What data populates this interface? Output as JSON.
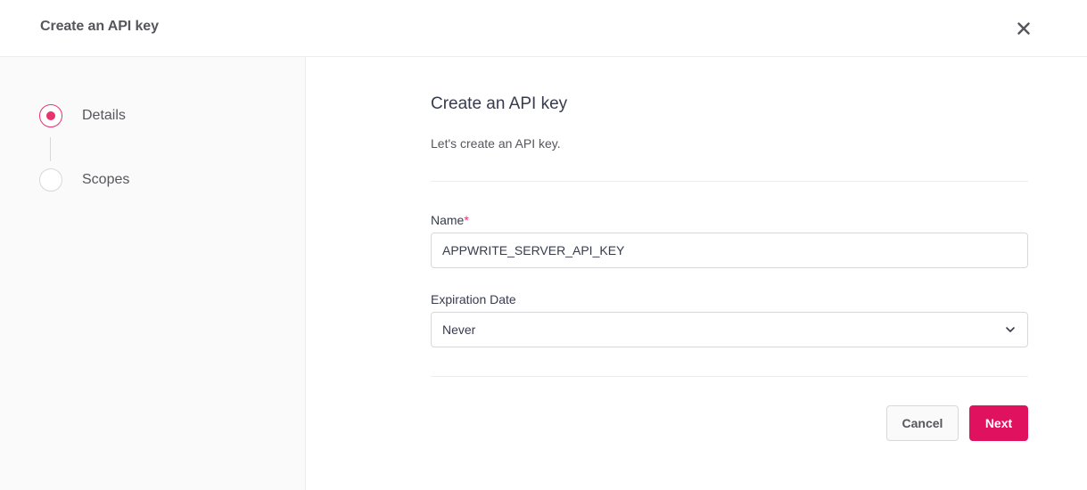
{
  "header": {
    "title": "Create an API key",
    "close_icon": "close-icon"
  },
  "steps": [
    {
      "label": "Details",
      "state": "active"
    },
    {
      "label": "Scopes",
      "state": "inactive"
    }
  ],
  "form": {
    "title": "Create an API key",
    "subtitle": "Let's create an API key.",
    "name": {
      "label": "Name",
      "required_mark": "*",
      "value": "APPWRITE_SERVER_API_KEY"
    },
    "expiration": {
      "label": "Expiration Date",
      "value": "Never",
      "icon": "chevron-down-icon"
    }
  },
  "actions": {
    "cancel_label": "Cancel",
    "next_label": "Next"
  },
  "colors": {
    "accent": "#e0115f",
    "step_active": "#e8336d",
    "sidebar_bg": "#fafafb",
    "border": "#d8d8db"
  }
}
